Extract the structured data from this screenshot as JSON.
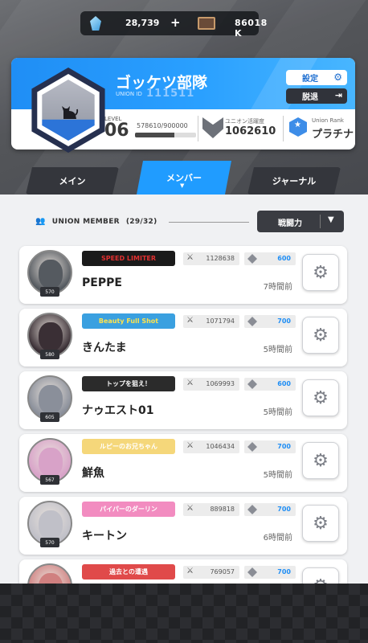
{
  "currency": {
    "gems": "28,739",
    "plus": "+",
    "credits": "86018 K"
  },
  "union": {
    "name": "ゴッケツ部隊",
    "id_label": "UNION ID",
    "id": "111511",
    "settings_label": "設定",
    "leave_label": "脱退",
    "level_label": "LEVEL",
    "level": "06",
    "exp_text": "578610/900000",
    "exp_fraction": 0.643,
    "activity_label": "ユニオン活躍度",
    "activity": "1062610",
    "rank_label": "Union Rank",
    "rank": "プラチナ"
  },
  "tabs": {
    "main": "メイン",
    "member": "メンバー",
    "member_caret": "▼",
    "journal": "ジャーナル"
  },
  "members_header": {
    "label": "UNION MEMBER",
    "count": "(29/32)"
  },
  "sort": {
    "label": "戦闘力",
    "arrow": "▼"
  },
  "colors": {
    "accent_blue": "#209cff",
    "dark_tab": "#34363c"
  },
  "members": [
    {
      "name": "PEPPE",
      "level": "570",
      "title": "SPEED LIMITER",
      "power": "1128638",
      "activity": "600",
      "last_login": "7時間前",
      "title_bg": "#1a1a1a",
      "title_fg": "#e03030",
      "avatar_color": "#555a60"
    },
    {
      "name": "きんたま",
      "level": "580",
      "title": "Beauty Full Shot",
      "power": "1071794",
      "activity": "700",
      "last_login": "5時間前",
      "title_bg": "#3aa0e0",
      "title_fg": "#ffe34d",
      "avatar_color": "#3a2f35"
    },
    {
      "name": "ナゥエスト01",
      "level": "605",
      "title": "トップを狙え！",
      "power": "1069993",
      "activity": "600",
      "last_login": "5時間前",
      "title_bg": "#2b2b2b",
      "title_fg": "#ffffff",
      "avatar_color": "#8a8f9a"
    },
    {
      "name": "鮮魚",
      "level": "567",
      "title": "ルピーのお兄ちゃん",
      "power": "1046434",
      "activity": "700",
      "last_login": "5時間前",
      "title_bg": "#f5d77a",
      "title_fg": "#ffffff",
      "avatar_color": "#d8a2c8"
    },
    {
      "name": "キートン",
      "level": "570",
      "title": "パイパーのダーリン",
      "power": "889818",
      "activity": "700",
      "last_login": "6時間前",
      "title_bg": "#f28cc0",
      "title_fg": "#ffffff",
      "avatar_color": "#c0c0c8"
    },
    {
      "name": "",
      "level": "",
      "title": "過去との遭遇",
      "power": "769057",
      "activity": "700",
      "last_login": "",
      "title_bg": "#e04a4a",
      "title_fg": "#ffffff",
      "avatar_color": "#d08080"
    }
  ]
}
